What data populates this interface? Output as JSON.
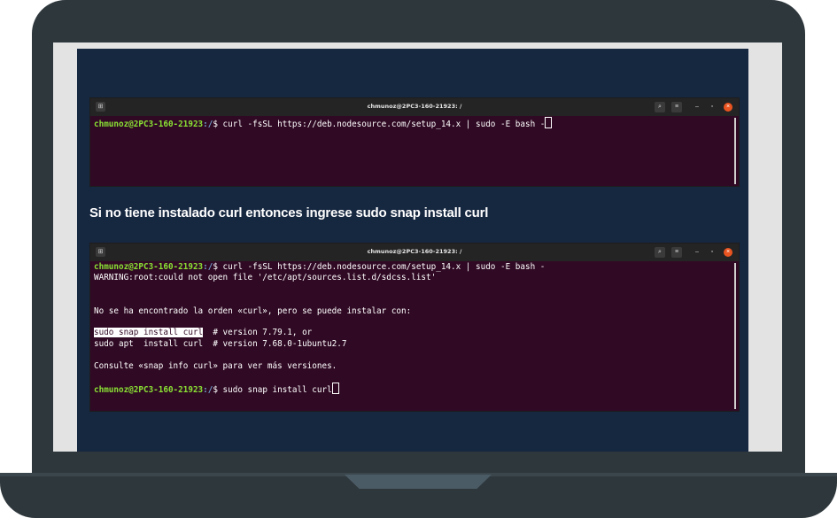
{
  "terminal1": {
    "title": "chmunoz@2PC3-160-21923: /",
    "lines": [
      {
        "user": "chmunoz@2PC3-160-21923",
        "path": ":/",
        "command": "$ curl -fsSL https://deb.nodesource.com/setup_14.x | sudo -E bash -"
      }
    ]
  },
  "caption": "Si no tiene instalado curl entonces ingrese sudo snap install curl",
  "terminal2": {
    "title": "chmunoz@2PC3-160-21923: /",
    "prompt1": {
      "user": "chmunoz@2PC3-160-21923",
      "path": ":/",
      "command": "$ curl -fsSL https://deb.nodesource.com/setup_14.x | sudo -E bash -"
    },
    "warning": "WARNING:root:could not open file '/etc/apt/sources.list.d/sdcss.list'",
    "not_found": "No se ha encontrado la orden «curl», pero se puede instalar con:",
    "option1_cmd": "sudo snap install curl",
    "option1_note": "  # version 7.79.1, or",
    "option2": "sudo apt  install curl  # version 7.68.0-1ubuntu2.7",
    "consult": "Consulte «snap info curl» para ver más versiones.",
    "prompt2": {
      "user": "chmunoz@2PC3-160-21923",
      "path": ":/",
      "command": "$ sudo snap install curl"
    }
  },
  "icons": {
    "new_tab": "new-tab-icon",
    "search": "search-icon",
    "menu": "hamburger-menu-icon",
    "minimize": "minimize-icon",
    "maximize": "maximize-icon",
    "close": "close-icon"
  }
}
